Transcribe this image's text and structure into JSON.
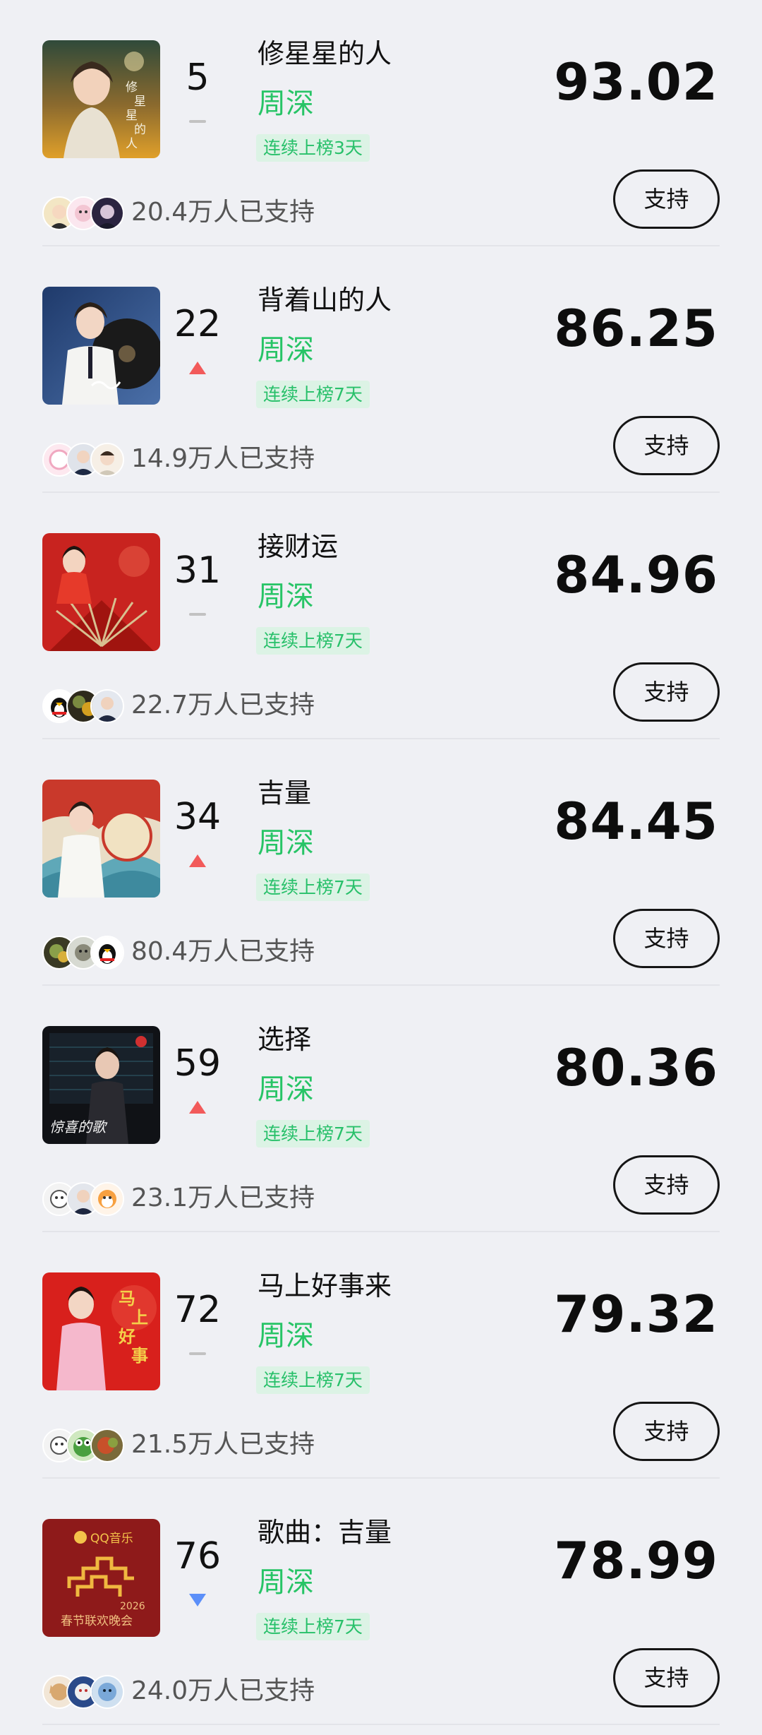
{
  "chart_list": [
    {
      "rank": "5",
      "trend": "same",
      "title": "修星星的人",
      "artist": "周深",
      "tag": "连续上榜3天",
      "score": "93.02",
      "supporters": "20.4万人已支持",
      "button": "支持"
    },
    {
      "rank": "22",
      "trend": "up",
      "title": "背着山的人",
      "artist": "周深",
      "tag": "连续上榜7天",
      "score": "86.25",
      "supporters": "14.9万人已支持",
      "button": "支持"
    },
    {
      "rank": "31",
      "trend": "same",
      "title": "接财运",
      "artist": "周深",
      "tag": "连续上榜7天",
      "score": "84.96",
      "supporters": "22.7万人已支持",
      "button": "支持"
    },
    {
      "rank": "34",
      "trend": "up",
      "title": "吉量",
      "artist": "周深",
      "tag": "连续上榜7天",
      "score": "84.45",
      "supporters": "80.4万人已支持",
      "button": "支持"
    },
    {
      "rank": "59",
      "trend": "up",
      "title": "选择",
      "artist": "周深",
      "tag": "连续上榜7天",
      "score": "80.36",
      "supporters": "23.1万人已支持",
      "button": "支持"
    },
    {
      "rank": "72",
      "trend": "same",
      "title": "马上好事来",
      "artist": "周深",
      "tag": "连续上榜7天",
      "score": "79.32",
      "supporters": "21.5万人已支持",
      "button": "支持"
    },
    {
      "rank": "76",
      "trend": "down",
      "title": "歌曲：吉量",
      "artist": "周深",
      "tag": "连续上榜7天",
      "score": "78.99",
      "supporters": "24.0万人已支持",
      "button": "支持"
    }
  ],
  "cover_texts": {
    "cover_1": [
      "修",
      "星",
      "星",
      "的",
      "人"
    ],
    "cover_5": "惊喜的歌",
    "cover_6": "马上好事",
    "cover_7_brand": "QQ音乐",
    "cover_7_year": "2026",
    "cover_7_event": "春节联欢晚会"
  },
  "colors": {
    "background": "#eff0f4",
    "artist": "#27c466",
    "tag_bg": "#dcf3e5",
    "trend_up": "#f25a5a",
    "trend_down": "#5b8ff9",
    "trend_same": "#c2c2c2"
  },
  "icons": {
    "up": "triangle-up-icon",
    "down": "triangle-down-icon",
    "same": "dash-icon"
  }
}
